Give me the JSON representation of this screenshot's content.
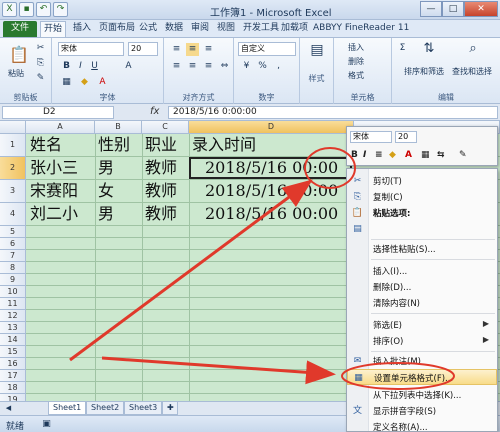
{
  "window": {
    "title": "工作簿1 - Microsoft Excel"
  },
  "tabs": [
    "文件",
    "开始",
    "插入",
    "页面布局",
    "公式",
    "数据",
    "审阅",
    "视图",
    "开发工具",
    "加载项",
    "ABBYY FineReader 11"
  ],
  "ribbon": {
    "clipboard": {
      "paste": "粘贴",
      "label": "剪贴板"
    },
    "font": {
      "name": "宋体",
      "size": "20",
      "label": "字体"
    },
    "alignment": {
      "label": "对齐方式"
    },
    "number": {
      "format": "自定义",
      "label": "数字"
    },
    "styles": {
      "label": "样式"
    },
    "cells": {
      "insert": "插入",
      "delete": "删除",
      "format": "格式",
      "label": "单元格"
    },
    "editing": {
      "sort": "排序和筛选",
      "find": "查找和选择",
      "label": "编辑"
    }
  },
  "formula_bar": {
    "name_box": "D2",
    "fx": "fx",
    "content": "2018/5/16  0:00:00"
  },
  "sheet": {
    "columns": [
      "A",
      "B",
      "C",
      "D"
    ],
    "rows": [
      "1",
      "2",
      "3",
      "4",
      "5",
      "6",
      "7",
      "8",
      "9",
      "10",
      "11",
      "12",
      "13",
      "14",
      "15",
      "16",
      "17",
      "18",
      "19"
    ],
    "cells": [
      [
        "姓名",
        "性别",
        "职业",
        "录入时间"
      ],
      [
        "张小三",
        "男",
        "教师",
        "2018/5/16  00:00"
      ],
      [
        "宋赛阳",
        "女",
        "教师",
        "2018/5/16  00:00"
      ],
      [
        "刘二小",
        "男",
        "教师",
        "2018/5/16  00:00"
      ]
    ]
  },
  "sheet_tabs": [
    "Sheet1",
    "Sheet2",
    "Sheet3"
  ],
  "status": {
    "ready": "就绪"
  },
  "mini_toolbar": {
    "font": "宋体",
    "size": "20"
  },
  "context_menu": {
    "items": [
      {
        "icon": "scissors-icon",
        "label": "剪切(T)"
      },
      {
        "icon": "copy-icon",
        "label": "复制(C)"
      },
      {
        "icon": "paste-icon",
        "label": "粘贴选项:"
      },
      {
        "icon": "blank",
        "label": "选择性粘贴(S)..."
      },
      {
        "icon": "blank",
        "label": "插入(I)..."
      },
      {
        "icon": "blank",
        "label": "删除(D)..."
      },
      {
        "icon": "blank",
        "label": "清除内容(N)"
      },
      {
        "icon": "blank",
        "label": "筛选(E)"
      },
      {
        "icon": "blank",
        "label": "排序(O)"
      },
      {
        "icon": "comment-icon",
        "label": "插入批注(M)"
      },
      {
        "icon": "format-cells-icon",
        "label": "设置单元格格式(F)..."
      },
      {
        "icon": "blank",
        "label": "从下拉列表中选择(K)..."
      },
      {
        "icon": "phonetic-icon",
        "label": "显示拼音字段(S)"
      },
      {
        "icon": "blank",
        "label": "定义名称(A)..."
      }
    ]
  },
  "colors": {
    "sheet_bg": "#cce8cf",
    "highlight": "#f8dc8a",
    "annotation": "#e0392b",
    "file_tab": "#2a7a2f"
  }
}
